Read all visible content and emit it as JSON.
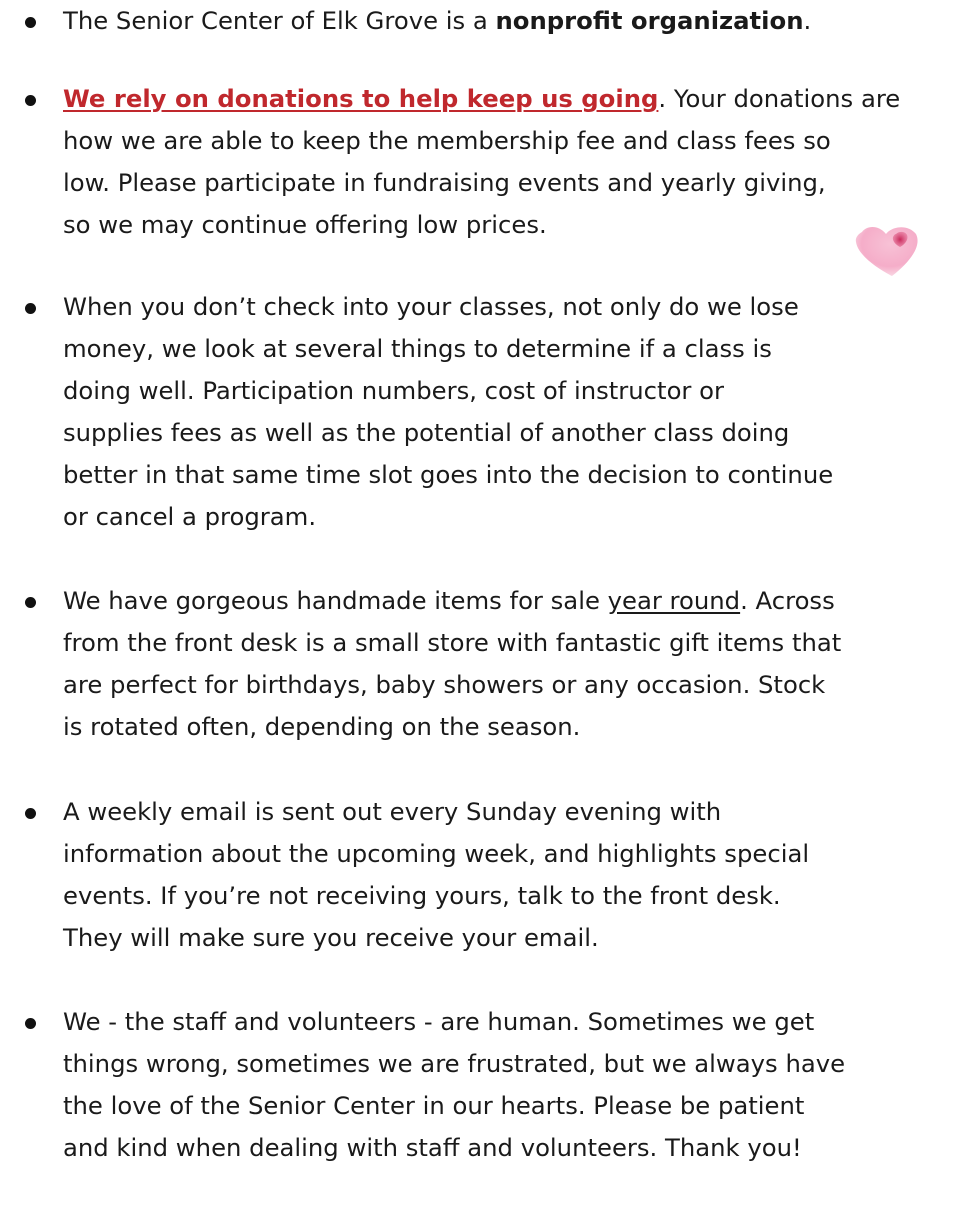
{
  "bullets": [
    {
      "lines": [
        [
          "The Senior Center of Elk Grove is a ",
          "nonprofit organization",
          "."
        ]
      ]
    },
    {
      "lines": [
        [
          "We rely on donations to help keep us going",
          ".  Your donations are"
        ],
        [
          "how we are able to keep the membership fee and class fees so"
        ],
        [
          "low.  Please participate in fundraising events and yearly giving,"
        ],
        [
          "so we may continue offering low prices."
        ]
      ]
    },
    {
      "lines": [
        [
          "When you don’t check into your classes, not only do we lose"
        ],
        [
          "money, we look at several things to determine if a class is"
        ],
        [
          "doing well.  Participation numbers, cost of instructor or"
        ],
        [
          "supplies fees as well as the potential of another class doing"
        ],
        [
          "better in that same time slot goes into the decision to continue"
        ],
        [
          "or cancel a program."
        ]
      ]
    },
    {
      "lines": [
        [
          "We have gorgeous handmade items for sale ",
          "year round",
          ".  Across"
        ],
        [
          "from the front desk is a small store with fantastic gift items that"
        ],
        [
          "are perfect for birthdays, baby showers or any occasion.  Stock"
        ],
        [
          "is rotated often, depending on the season."
        ]
      ]
    },
    {
      "lines": [
        [
          "A weekly email is sent out every Sunday evening with"
        ],
        [
          "information about the upcoming week, and highlights special"
        ],
        [
          "events.  If you’re not receiving yours, talk to the front desk."
        ],
        [
          "They will make sure you receive your email."
        ]
      ]
    },
    {
      "lines": [
        [
          "We - the staff and volunteers - are human.  Sometimes we get"
        ],
        [
          "things wrong, sometimes we are frustrated, but we always have"
        ],
        [
          "the love of the Senior Center in our hearts.  Please be patient"
        ],
        [
          "and kind when dealing with staff and volunteers. Thank you!"
        ]
      ]
    }
  ],
  "colors": {
    "text": "#1a1a1a",
    "link_red": "#c0282d",
    "heart_pink": "#f4a6c4",
    "heart_core": "#d43c6e"
  },
  "icons": {
    "heart": "heart-icon"
  }
}
